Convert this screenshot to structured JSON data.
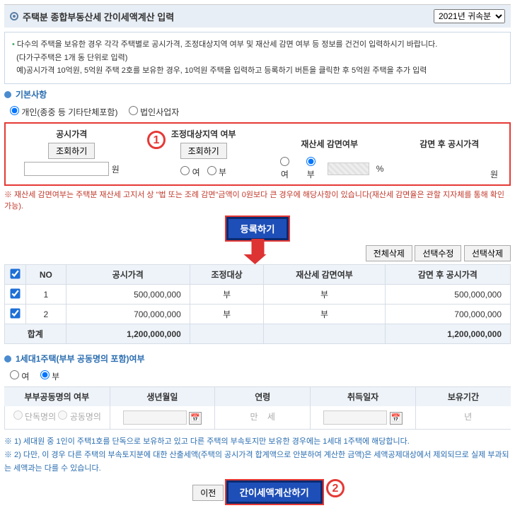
{
  "header": {
    "title": "주택분 종합부동산세 간이세액계산 입력",
    "year_select": "2021년 귀속분"
  },
  "infobox": {
    "line1": "다수의 주택을 보유한 경우 각각 주택별로 공시가격, 조정대상지역 여부 및 재산세 감면 여부 등 정보를 건건이 입력하시기 바랍니다.",
    "line2": "(다가구주택은 1개 동 단위로 입력)",
    "line3": "예)공시가격 10억원, 5억원 주택 2호를 보유한 경우, 10억원 주택을 입력하고 등록하기 버튼을 클릭한 후 5억원 주택을 추가 입력"
  },
  "basic": {
    "heading": "기본사항",
    "entity_individual": "개인(종중 등 기타단체포함)",
    "entity_corp": "법인사업자",
    "cols": {
      "price": "공시가격",
      "lookup": "조회하기",
      "adjzone": "조정대상지역 여부",
      "tax_reduce": "재산세 감면여부",
      "after_price": "감면 후 공시가격"
    },
    "yes": "여",
    "no": "부",
    "won": "원",
    "pct": "%",
    "footnote": "※ 재산세 감면여부는 주택분 재산세 고지서 상 \"법 또는 조례 감면\"금액이 0원보다 큰 경우에 해당사항이 있습니다(재산세 감면율은 관할 지자체를 통해 확인 가능)."
  },
  "register_btn": "등록하기",
  "toolbar": {
    "del_all": "전체삭제",
    "edit_sel": "선택수정",
    "del_sel": "선택삭제"
  },
  "table": {
    "head": {
      "no": "NO",
      "price": "공시가격",
      "adj": "조정대상",
      "reduce": "재산세 감면여부",
      "after": "감면 후 공시가격"
    },
    "rows": [
      {
        "no": "1",
        "price": "500,000,000",
        "adj": "부",
        "reduce": "부",
        "after": "500,000,000"
      },
      {
        "no": "2",
        "price": "700,000,000",
        "adj": "부",
        "reduce": "부",
        "after": "700,000,000"
      }
    ],
    "sum_label": "합계",
    "sum_price": "1,200,000,000",
    "sum_after": "1,200,000,000"
  },
  "one_house": {
    "heading": "1세대1주택(부부 공동명의 포함)여부",
    "yes": "여",
    "no": "부",
    "cols": {
      "joint": "부부공동명의 여부",
      "birth": "생년월일",
      "age": "연령",
      "acq": "취득일자",
      "hold": "보유기간"
    },
    "single": "단독명의",
    "joint": "공동명의",
    "age_unit1": "만",
    "age_unit2": "세",
    "year_unit": "년"
  },
  "notes": {
    "n1": "※ 1) 세대원 중 1인이 주택1호를 단독으로 보유하고 있고 다른 주택의 부속토지만 보유한 경우에는 1세대 1주택에 해당합니다.",
    "n2": "※ 2) 다만, 이 경우 다른 주택의 부속토지분에 대한 산출세액(주택의 공시가격 합계액으로 안분하여 계산한 금액)은 세액공제대상에서 제외되므로 실제 부과되는 세액과는 다를 수 있습니다."
  },
  "bottom": {
    "prev": "이전",
    "calc": "간이세액계산하기"
  }
}
